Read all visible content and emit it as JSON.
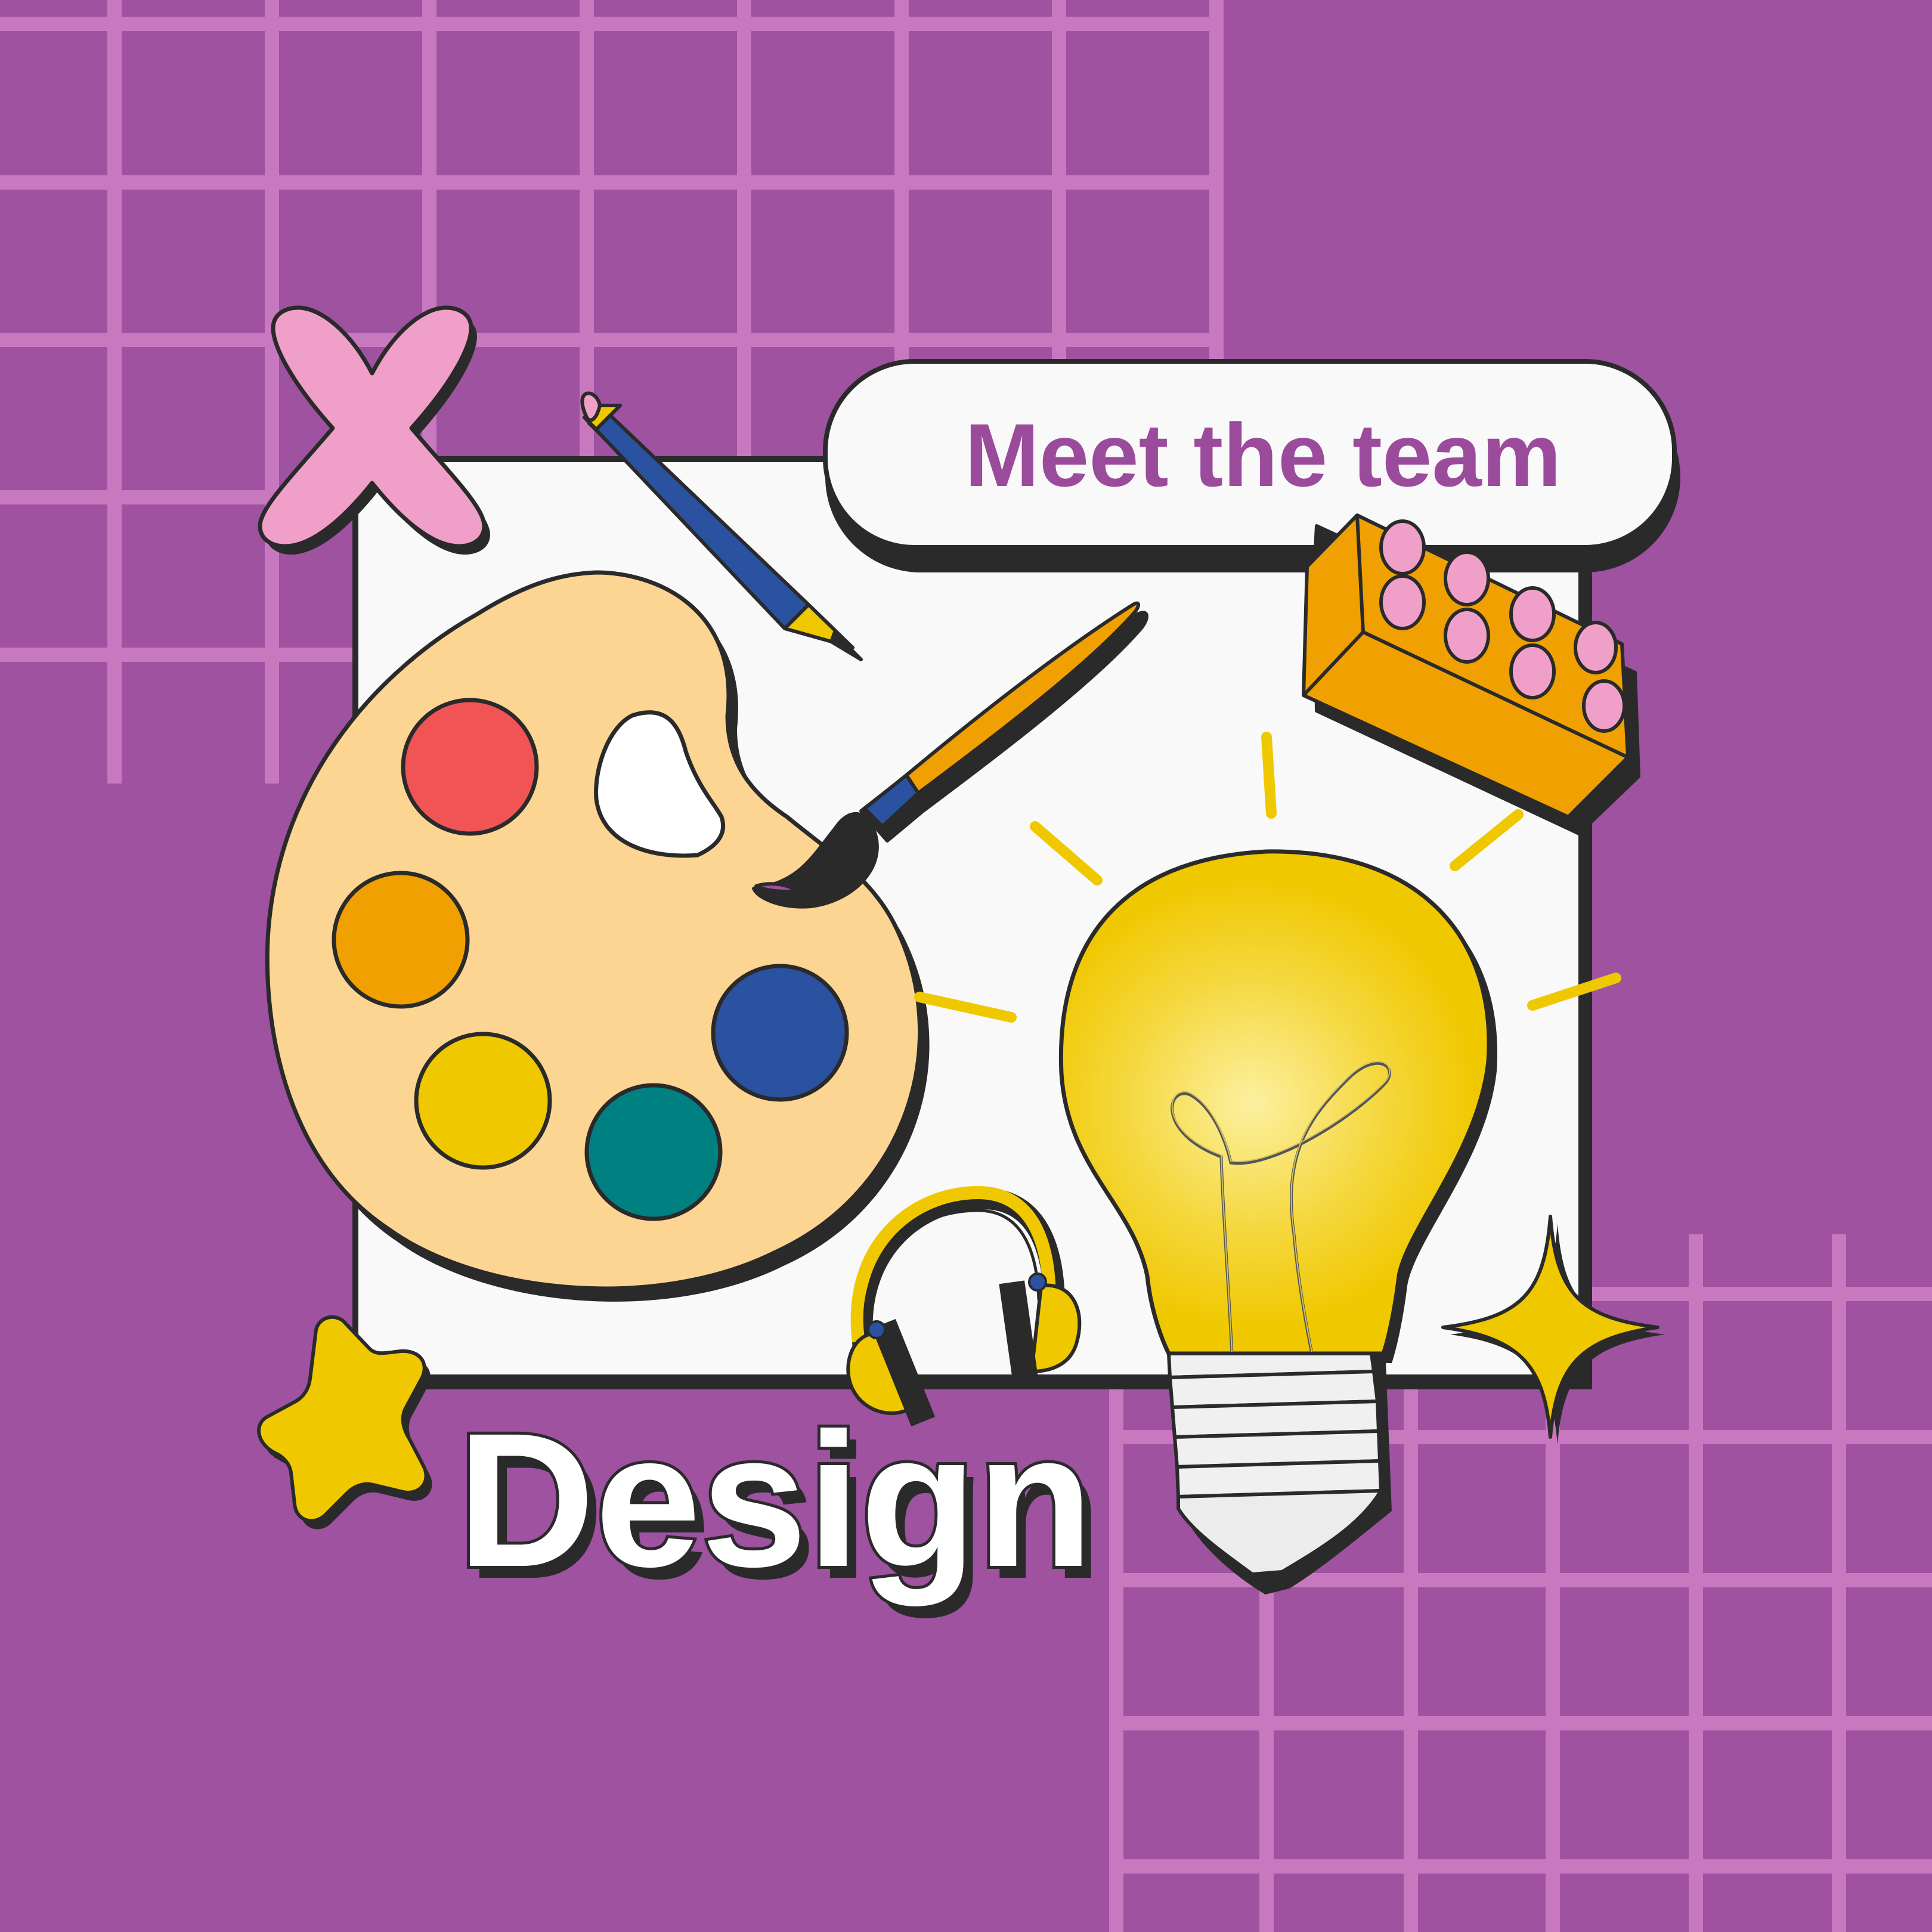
{
  "header": {
    "title": "Meet the team"
  },
  "main": {
    "label": "Design"
  },
  "colors": {
    "background": "#9e52a0",
    "grid": "#c878bf",
    "title_text": "#9b4b9c",
    "outline": "#2a2a2a",
    "card": "#f9f9f9",
    "palette_wood": "#fdd592",
    "paint_red": "#f05454",
    "paint_orange": "#f0a000",
    "paint_yellow": "#f0c800",
    "paint_blue": "#2a52a0",
    "paint_teal": "#008080",
    "pink": "#f0a0c8",
    "yellow": "#f0c800",
    "orange": "#f0a000",
    "blue": "#2a52a0"
  },
  "icons": [
    "x-shape-icon",
    "pencil-icon",
    "paintbrush-icon",
    "paint-palette-icon",
    "lego-brick-icon",
    "lightbulb-icon",
    "headphones-icon",
    "star-icon",
    "sparkle-icon"
  ]
}
